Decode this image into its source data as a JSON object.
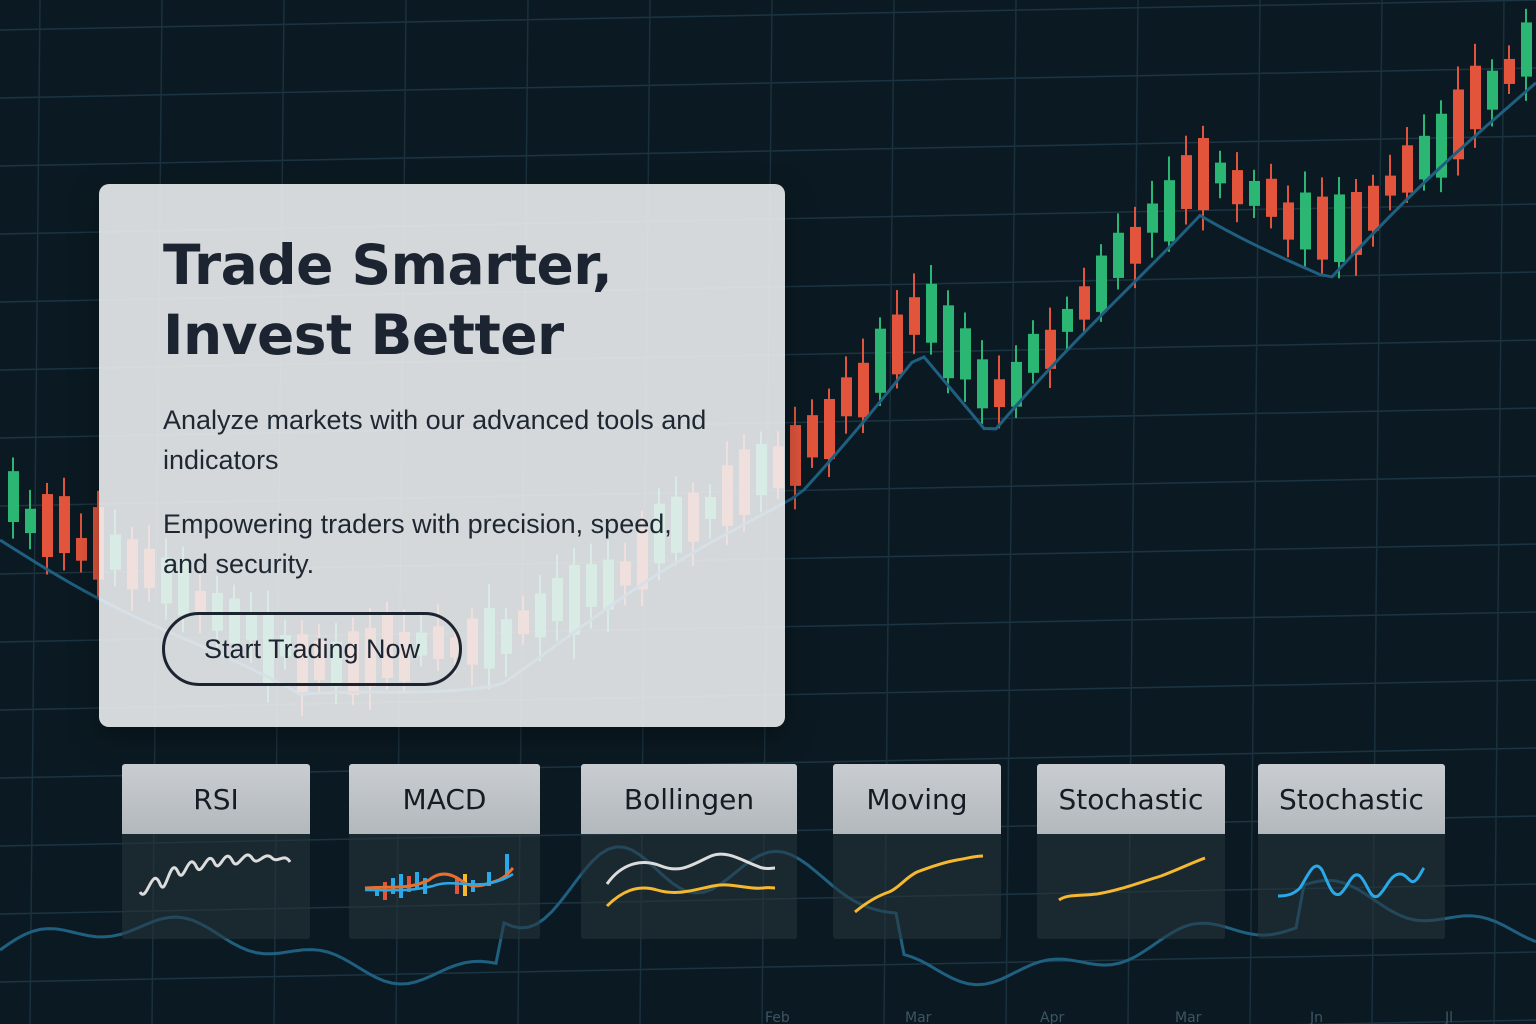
{
  "hero": {
    "title_line1": "Trade Smarter,",
    "title_line2": "Invest Better",
    "subtitle": "Analyze markets with our advanced tools and indicators",
    "tagline": "Empowering traders with precision, speed, and security.",
    "cta_label": "Start Trading Now"
  },
  "indicators": [
    {
      "label": "RSI",
      "icon": "rsi-chart-icon"
    },
    {
      "label": "MACD",
      "icon": "macd-chart-icon"
    },
    {
      "label": "Bollingen",
      "icon": "bollinger-chart-icon"
    },
    {
      "label": "Moving",
      "icon": "moving-average-chart-icon"
    },
    {
      "label": "Stochastic",
      "icon": "stochastic-chart-icon"
    },
    {
      "label": "Stochastic",
      "icon": "stochastic-wave-chart-icon"
    }
  ],
  "colors": {
    "background": "#0b1a22",
    "bullish_candle": "#2bb673",
    "bearish_candle": "#e2553c",
    "trend_line": "#1f5f80",
    "indicator_yellow": "#f5b82e",
    "indicator_blue": "#2aa9e8",
    "indicator_white": "#dcdcdc"
  },
  "axis_months": [
    "Feb",
    "Mar",
    "Apr",
    "Mar",
    "Jn",
    "Jl"
  ]
}
